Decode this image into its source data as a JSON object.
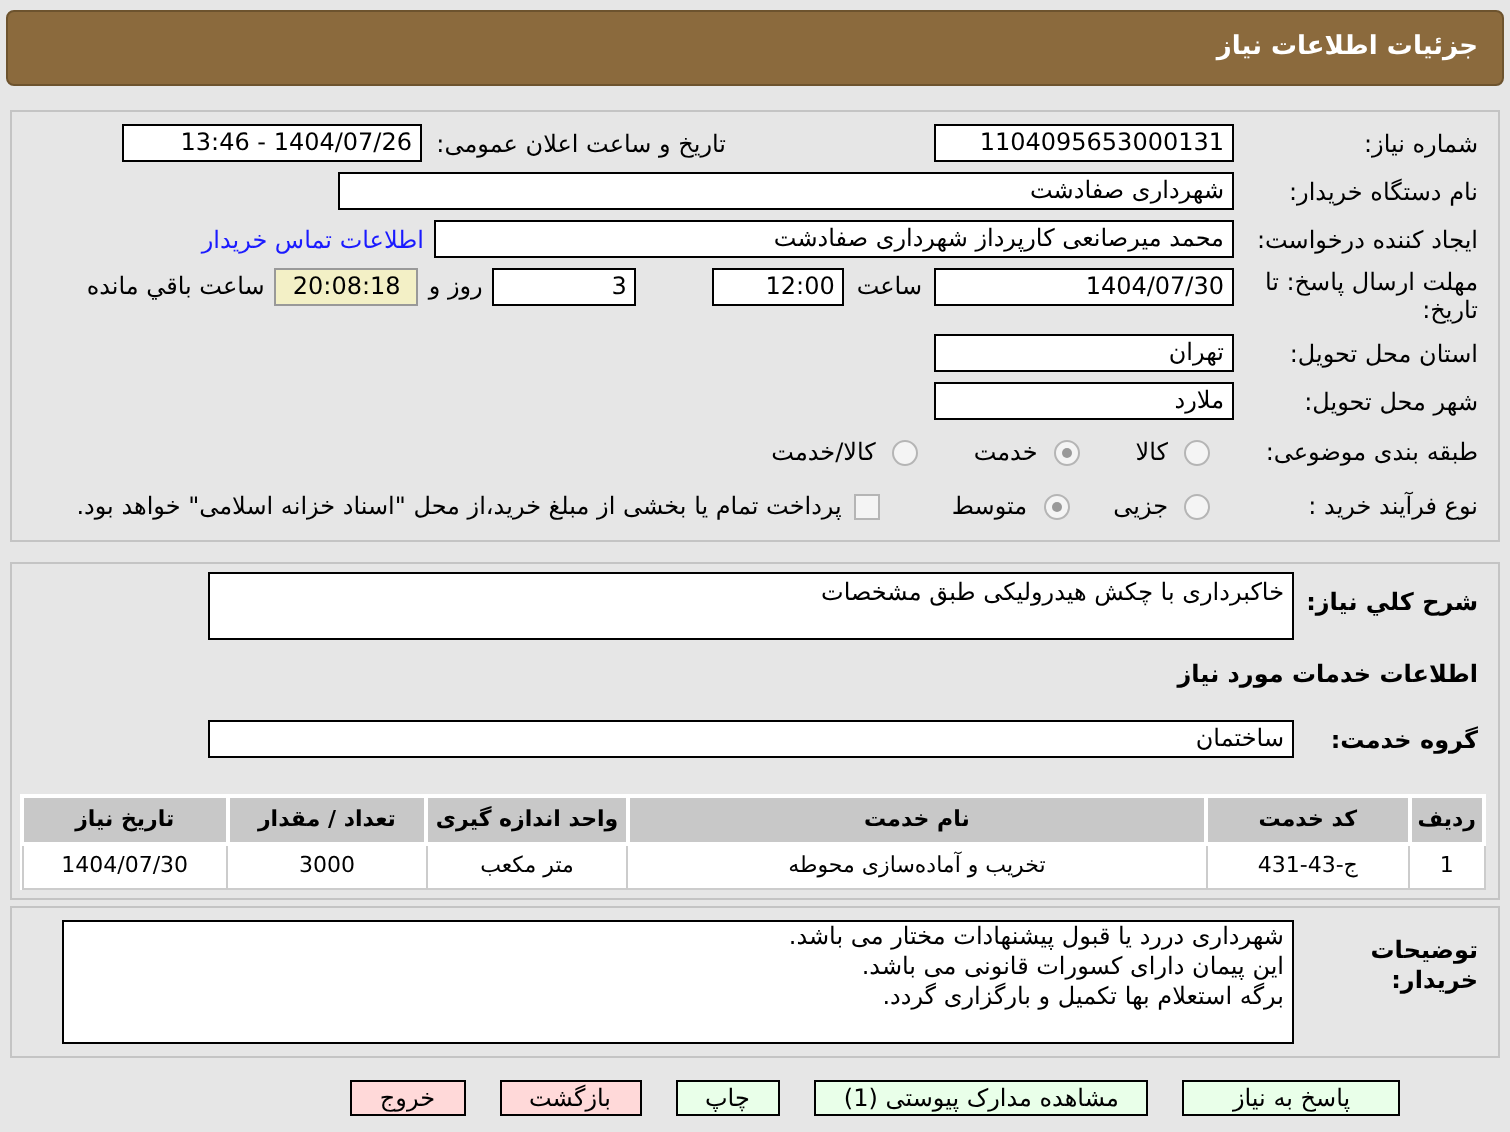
{
  "header": {
    "title": "جزئیات اطلاعات نیاز"
  },
  "info": {
    "need_number": {
      "label": "شماره نیاز:",
      "value": "1104095653000131"
    },
    "announce": {
      "label": "تاریخ و ساعت اعلان عمومی:",
      "value": "1404/07/26 - 13:46"
    },
    "buyer": {
      "label": "نام دستگاه خریدار:",
      "value": "شهرداری صفادشت"
    },
    "creator": {
      "label": "ایجاد کننده درخواست:",
      "value": "محمد میرصانعی کارپرداز شهرداری صفادشت",
      "link": "اطلاعات تماس خریدار"
    },
    "deadline": {
      "label": "مهلت ارسال پاسخ: تا تاریخ:",
      "date": "1404/07/30",
      "time_label": "ساعت",
      "time": "12:00",
      "days": "3",
      "days_label": "روز و",
      "remaining": "20:08:18",
      "remaining_label": "ساعت باقي مانده"
    },
    "province": {
      "label": "استان محل تحویل:",
      "value": "تهران"
    },
    "city": {
      "label": "شهر محل تحویل:",
      "value": "ملارد"
    },
    "category": {
      "label": "طبقه بندی موضوعی:",
      "options": [
        {
          "label": "کالا",
          "selected": false
        },
        {
          "label": "خدمت",
          "selected": true
        },
        {
          "label": "کالا/خدمت",
          "selected": false
        }
      ]
    },
    "purchase": {
      "label": "نوع فرآیند خرید :",
      "options": [
        {
          "label": "جزیی",
          "selected": false
        },
        {
          "label": "متوسط",
          "selected": true
        }
      ],
      "checkbox": {
        "checked": false,
        "label": "پرداخت تمام یا بخشی از مبلغ خرید،از محل \"اسناد خزانه اسلامی\" خواهد بود."
      }
    }
  },
  "need": {
    "description_label": "شرح کلي نیاز:",
    "description": "خاکبرداری با چکش هیدرولیکی طبق مشخصات",
    "services_heading": "اطلاعات خدمات مورد نیاز",
    "group_label": "گروه خدمت:",
    "group": "ساختمان",
    "table": {
      "columns": [
        "ردیف",
        "کد خدمت",
        "نام خدمت",
        "واحد اندازه گیری",
        "تعداد / مقدار",
        "تاریخ نیاز"
      ],
      "rows": [
        [
          "1",
          "ج-43-431",
          "تخریب و آماده‌سازی محوطه",
          "متر مکعب",
          "3000",
          "1404/07/30"
        ]
      ]
    }
  },
  "comments": {
    "label": "توضیحات خریدار:",
    "lines": [
      "شهرداری دررد یا قبول پیشنهادات مختار می باشد.",
      "این پیمان دارای کسورات قانونی می باشد.",
      "برگه استعلام بها تکمیل و بارگزاری گردد."
    ]
  },
  "buttons": [
    {
      "label": "پاسخ به نیاز",
      "kind": "primary"
    },
    {
      "label": "مشاهده مدارک پیوستی (1)",
      "kind": "primary"
    },
    {
      "label": "چاپ",
      "kind": "primary"
    },
    {
      "label": "بازگشت",
      "kind": "danger"
    },
    {
      "label": "خروج",
      "kind": "danger"
    }
  ]
}
